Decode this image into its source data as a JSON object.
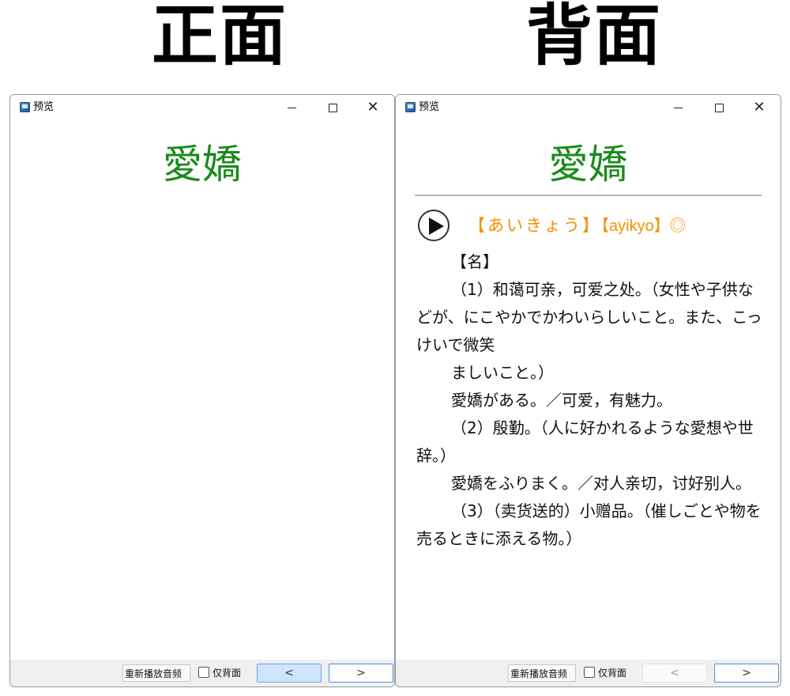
{
  "headings": {
    "front": "正面",
    "back": "背面"
  },
  "front_window": {
    "title": "预览",
    "word": "愛嬌",
    "replay_label": "重新播放音频",
    "back_only_label": "仅背面",
    "prev_label": "<",
    "next_label": ">"
  },
  "back_window": {
    "title": "预览",
    "word": "愛嬌",
    "reading_kana": "【あいきょう】",
    "reading_roma": "【ayikyo】◎",
    "definition": [
      "【名】",
      "（1）和蔼可亲，可爱之处。（女性や子供などが、にこやかでかわいらしいこと。また、こっけいで微笑",
      "ましいこと。）",
      "愛嬌がある。／可爱，有魅力。",
      "（2）殷勤。（人に好かれるような愛想や世辞。）",
      "愛嬌をふりまく。／对人亲切，讨好别人。",
      "（3）（卖货送的）小赠品。（催しごとや物を売るときに添える物。）"
    ],
    "replay_label": "重新播放音频",
    "back_only_label": "仅背面",
    "prev_label": "<",
    "next_label": ">"
  },
  "window_controls": {
    "minimize": "minimize-icon",
    "maximize": "maximize-icon",
    "close_glyph": "✕"
  },
  "colors": {
    "word": "#1a8a1a",
    "reading": "#f29100",
    "focus_border": "#4a8fe0",
    "pressed_bg": "#cfe5fb"
  }
}
